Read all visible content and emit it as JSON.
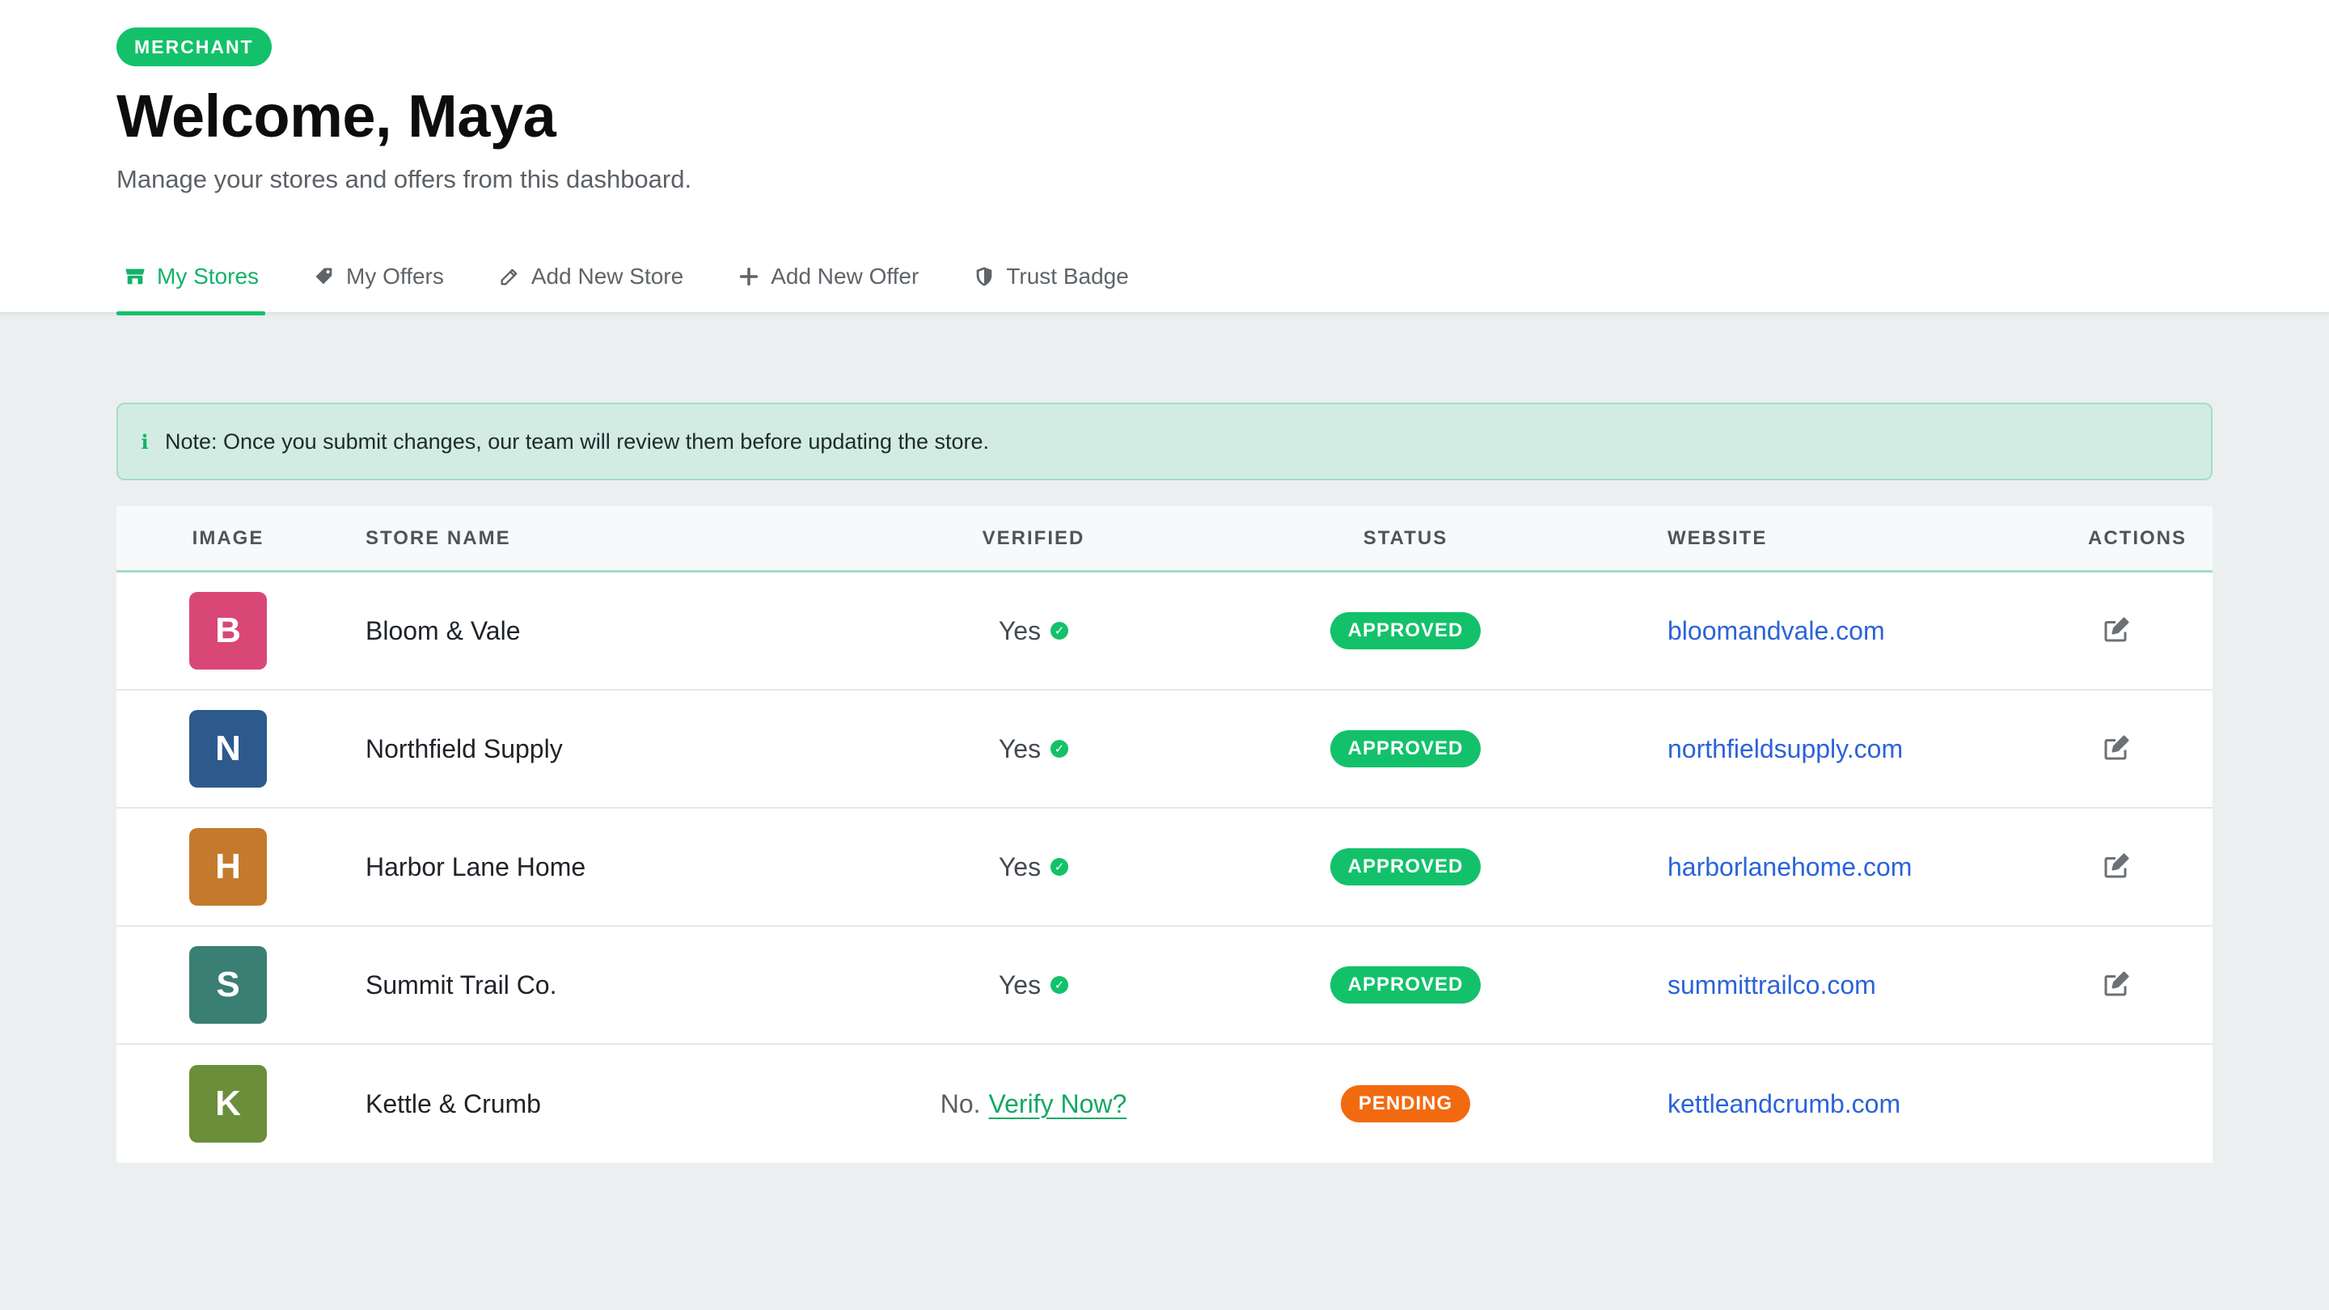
{
  "header": {
    "role_badge": "MERCHANT",
    "title": "Welcome, Maya",
    "subtitle": "Manage your stores and offers from this dashboard."
  },
  "tabs": [
    {
      "label": "My Stores",
      "icon": "store-icon",
      "active": true
    },
    {
      "label": "My Offers",
      "icon": "tag-icon",
      "active": false
    },
    {
      "label": "Add New Store",
      "icon": "pencil-icon",
      "active": false
    },
    {
      "label": "Add New Offer",
      "icon": "plus-icon",
      "active": false
    },
    {
      "label": "Trust Badge",
      "icon": "shield-icon",
      "active": false
    }
  ],
  "note": {
    "text": "Note: Once you submit changes, our team will review them before updating the store."
  },
  "table": {
    "columns": {
      "image": "IMAGE",
      "store_name": "STORE NAME",
      "verified": "VERIFIED",
      "status": "STATUS",
      "website": "WEBSITE",
      "actions": "ACTIONS"
    },
    "rows": [
      {
        "initial": "B",
        "color": "#d94777",
        "name": "Bloom & Vale",
        "verified": true,
        "verified_text": "Yes",
        "status": "APPROVED",
        "website": "bloomandvale.com",
        "editable": true
      },
      {
        "initial": "N",
        "color": "#2d5a8c",
        "name": "Northfield Supply",
        "verified": true,
        "verified_text": "Yes",
        "status": "APPROVED",
        "website": "northfieldsupply.com",
        "editable": true
      },
      {
        "initial": "H",
        "color": "#c47a2c",
        "name": "Harbor Lane Home",
        "verified": true,
        "verified_text": "Yes",
        "status": "APPROVED",
        "website": "harborlanehome.com",
        "editable": true
      },
      {
        "initial": "S",
        "color": "#3a7f73",
        "name": "Summit Trail Co.",
        "verified": true,
        "verified_text": "Yes",
        "status": "APPROVED",
        "website": "summittrailco.com",
        "editable": true
      },
      {
        "initial": "K",
        "color": "#6b8e3a",
        "name": "Kettle & Crumb",
        "verified": false,
        "verified_text": "No.",
        "verify_link": "Verify Now?",
        "status": "PENDING",
        "website": "kettleandcrumb.com",
        "editable": false
      }
    ]
  },
  "colors": {
    "accent": "#13c16b",
    "approved": "#13c16b",
    "pending": "#f26a10",
    "link": "#2b63d9"
  }
}
